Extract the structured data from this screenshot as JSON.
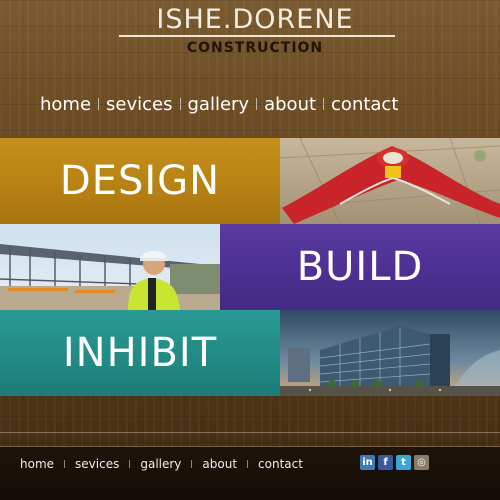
{
  "brand": {
    "title": "ISHE.DORENE",
    "subtitle": "CONSTRUCTION"
  },
  "nav": {
    "items": [
      "home",
      "sevices",
      "gallery",
      "about",
      "contact"
    ]
  },
  "panels": {
    "design": "DESIGN",
    "build": "BUILD",
    "inhibit": "INHIBIT"
  },
  "footer": {
    "items": [
      "home",
      "sevices",
      "gallery",
      "about",
      "contact"
    ]
  },
  "social": {
    "linkedin": "in",
    "facebook": "f",
    "twitter": "t",
    "instagram": "◎"
  },
  "colors": {
    "design_panel": "#b98314",
    "build_panel": "#4e3194",
    "inhibit_panel": "#238c86",
    "wood": "#6b4a22"
  }
}
